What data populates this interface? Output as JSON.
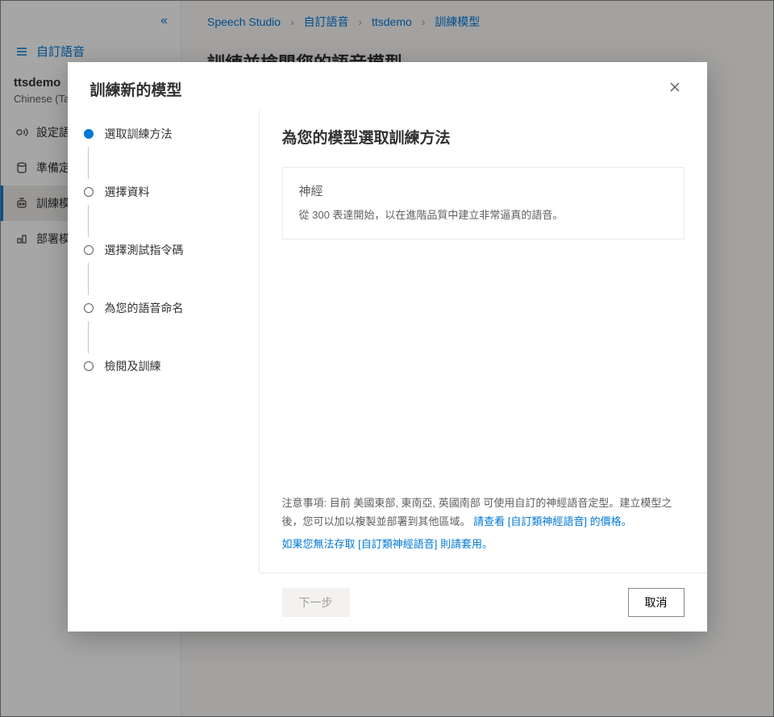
{
  "breadcrumb": {
    "items": [
      "Speech Studio",
      "自訂語音",
      "ttsdemo",
      "訓練模型"
    ]
  },
  "sidebar": {
    "collapse_glyph": "«",
    "header_label": "自訂語音",
    "project_name": "ttsdemo",
    "project_sub": "Chinese (Taiwan)",
    "nav": [
      {
        "label": "設定語音人才",
        "icon": "voice"
      },
      {
        "label": "準備定型資料",
        "icon": "database"
      },
      {
        "label": "訓練模型",
        "icon": "robot",
        "active": true
      },
      {
        "label": "部署模型",
        "icon": "deploy"
      }
    ]
  },
  "page_title": "訓練並檢閱您的語音模型",
  "modal": {
    "title": "訓練新的模型",
    "steps": [
      {
        "label": "選取訓練方法",
        "active": true
      },
      {
        "label": "選擇資料"
      },
      {
        "label": "選擇測試指令碼"
      },
      {
        "label": "為您的語音命名"
      },
      {
        "label": "檢閱及訓練"
      }
    ],
    "content_title": "為您的模型選取訓練方法",
    "option": {
      "title": "神經",
      "desc": "從 300 表達開始，以在進階品質中建立非常逼真的語音。"
    },
    "note_prefix": "注意事項: 目前 美國東部, 東南亞, 英國南部 可使用自訂的神經語音定型。建立模型之後，您可以加以複製並部署到其他區域。 ",
    "note_link1": "請查看 [自訂類神經語音] 的價格。",
    "note_link2": "如果您無法存取 [自訂類神經語音] 則請套用。",
    "next_label": "下一步",
    "cancel_label": "取消"
  }
}
